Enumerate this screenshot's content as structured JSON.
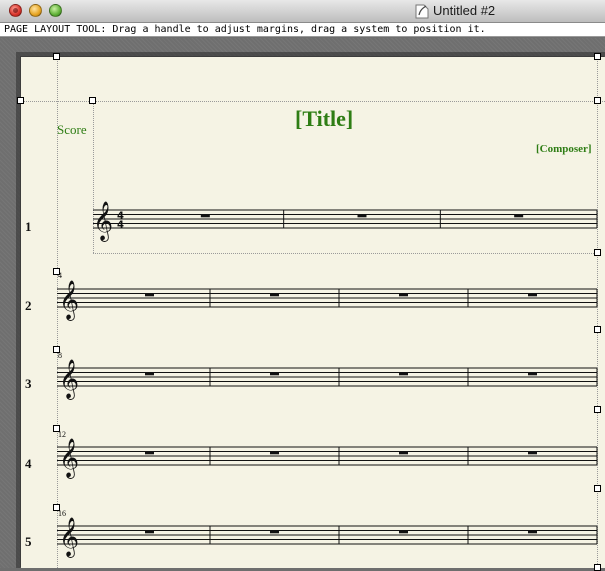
{
  "window": {
    "title": "Untitled #2",
    "controls": [
      "close-button",
      "minimize-button",
      "zoom-button"
    ]
  },
  "status_bar": {
    "message": "PAGE LAYOUT TOOL: Drag a handle to adjust margins, drag a system to position it."
  },
  "score": {
    "part_label": "Score",
    "title": "[Title]",
    "composer": "[Composer]",
    "time_signature": "4/4",
    "clef": "treble",
    "colors": {
      "text_placeholder": "#2e7d14",
      "paper": "#f5f3e4",
      "workspace": "#6f6f6f"
    },
    "systems": [
      {
        "number": "1",
        "measures": 3,
        "first_bar_label": ""
      },
      {
        "number": "2",
        "measures": 4,
        "first_bar_label": "4"
      },
      {
        "number": "3",
        "measures": 4,
        "first_bar_label": "8"
      },
      {
        "number": "4",
        "measures": 4,
        "first_bar_label": "12"
      },
      {
        "number": "5",
        "measures": 4,
        "first_bar_label": "16"
      }
    ],
    "measure_content": "whole-rest"
  }
}
